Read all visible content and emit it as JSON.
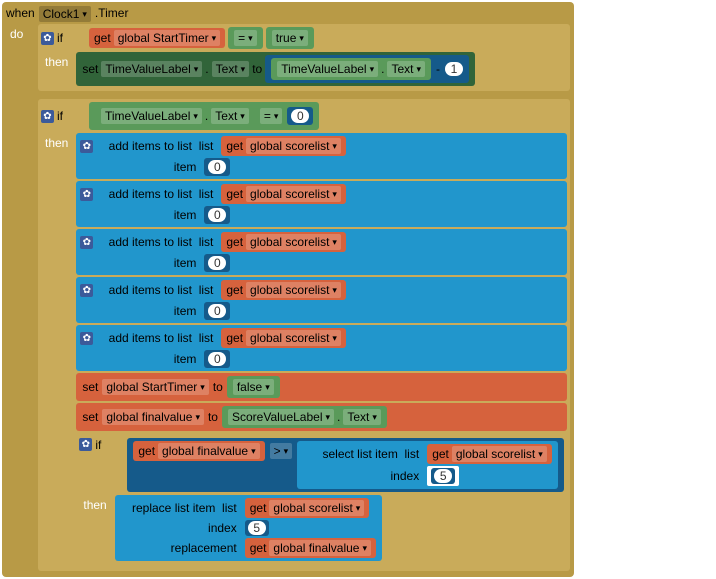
{
  "event": {
    "when": "when",
    "component": "Clock1",
    "event_name": ".Timer",
    "do": "do"
  },
  "if1": {
    "if": "if",
    "then": "then",
    "get": "get",
    "var": "global StartTimer",
    "eq": "=",
    "true": "true"
  },
  "setTimeValue": {
    "set": "set",
    "comp": "TimeValueLabel",
    "prop": "Text",
    "to": "to",
    "comp2": "TimeValueLabel",
    "prop2": "Text",
    "minus": "-",
    "one": "1"
  },
  "if2": {
    "if": "if",
    "then": "then",
    "comp": "TimeValueLabel",
    "prop": "Text",
    "eq": "=",
    "zero": "0"
  },
  "addItems": {
    "label": "add items to list",
    "list": "list",
    "item": "item",
    "get": "get",
    "scorelist": "global scorelist",
    "zero": "0"
  },
  "setStartTimer": {
    "set": "set",
    "var": "global StartTimer",
    "to": "to",
    "false": "false"
  },
  "setFinal": {
    "set": "set",
    "var": "global finalvalue",
    "to": "to",
    "comp": "ScoreValueLabel",
    "prop": "Text"
  },
  "if3": {
    "if": "if",
    "then": "then",
    "get": "get",
    "finalvalue": "global finalvalue",
    "gt": ">",
    "select": "select list item",
    "list": "list",
    "index": "index",
    "scorelist": "global scorelist",
    "five": "5"
  },
  "replace": {
    "label": "replace list item",
    "list": "list",
    "index": "index",
    "replacement": "replacement",
    "get": "get",
    "scorelist": "global scorelist",
    "five": "5",
    "finalvalue": "global finalvalue"
  }
}
